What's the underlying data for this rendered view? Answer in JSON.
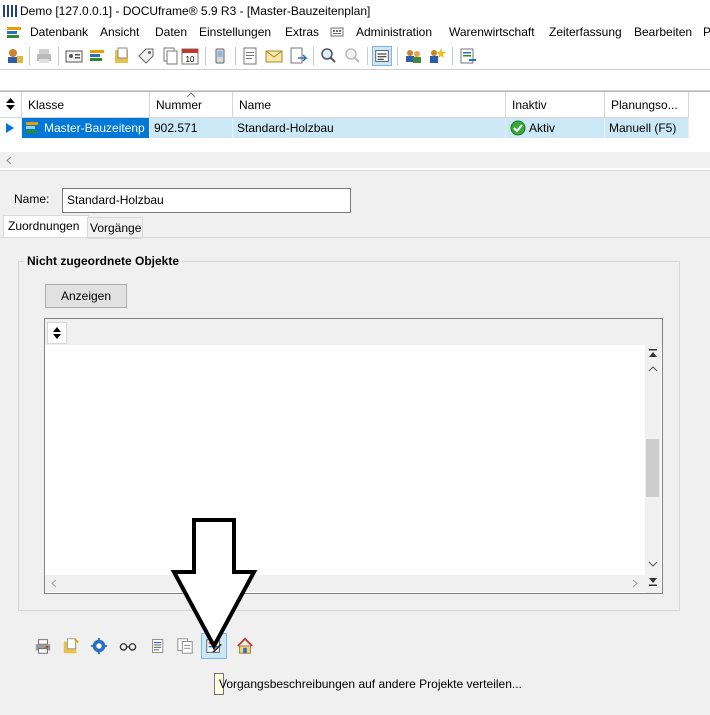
{
  "window": {
    "title": "Demo [127.0.0.1] - DOCUframe® 5.9 R3 - [Master-Bauzeitenplan]"
  },
  "menu": {
    "items": [
      "Datenbank",
      "Ansicht",
      "Daten",
      "Einstellungen",
      "Extras",
      "Administration",
      "Warenwirtschaft",
      "Zeiterfassung",
      "Bearbeiten",
      "P"
    ]
  },
  "grid": {
    "columns": [
      "Klasse",
      "Nummer",
      "Name",
      "Inaktiv",
      "Planungso..."
    ],
    "row": {
      "klasse": "Master-Bauzeitenp",
      "nummer": "902.571",
      "name": "Standard-Holzbau",
      "inaktiv": "Aktiv",
      "planung": "Manuell (F5)"
    }
  },
  "detail": {
    "name_label": "Name:",
    "name_value": "Standard-Holzbau",
    "tabs": [
      "Zuordnungen",
      "Vorgänge"
    ],
    "group_title": "Nicht zugeordnete Objekte",
    "show_button": "Anzeigen"
  },
  "tooltip": "Vorgangsbeschreibungen auf andere Projekte verteilen...",
  "colors": {
    "selection": "#cce8f7",
    "accent": "#0078d7",
    "panel": "#f0f0f0"
  }
}
